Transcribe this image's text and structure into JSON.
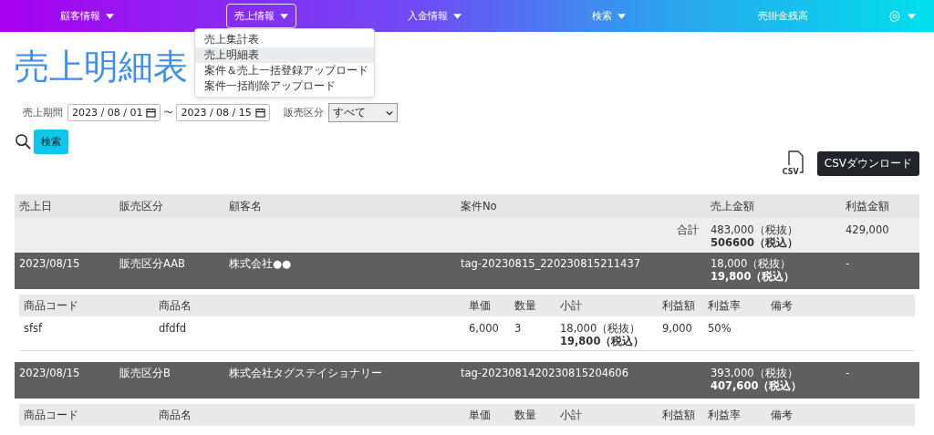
{
  "nav": {
    "items": [
      {
        "label": "顧客情報",
        "caret": true,
        "selected": false
      },
      {
        "label": "売上情報",
        "caret": true,
        "selected": true
      },
      {
        "label": "入金情報",
        "caret": true,
        "selected": false
      },
      {
        "label": "検索",
        "caret": true,
        "selected": false
      },
      {
        "label": "売掛金残高",
        "caret": false,
        "selected": false
      }
    ],
    "settings_caret": true
  },
  "dropdown": {
    "items": [
      {
        "label": "売上集計表",
        "selected": false
      },
      {
        "label": "売上明細表",
        "selected": true
      },
      {
        "label": "案件＆売上一括登録アップロード",
        "selected": false
      },
      {
        "label": "案件一括削除アップロード",
        "selected": false
      }
    ]
  },
  "page_title": "売上明細表",
  "filters": {
    "period_label": "売上期間",
    "date_from": "2023 / 08 / 01",
    "separator": "〜",
    "date_to": "2023 / 08 / 15",
    "category_label": "販売区分",
    "category_value": "すべて"
  },
  "search_button": "検索",
  "csv": {
    "icon_text": "CSV",
    "button": "CSVダウンロード"
  },
  "table": {
    "columns": [
      "売上日",
      "販売区分",
      "顧客名",
      "案件No",
      "売上金額",
      "利益金額"
    ],
    "total": {
      "label": "合計",
      "amount_excl": "483,000（税抜）",
      "amount_incl": "506600（税込）",
      "profit": "429,000"
    },
    "orders": [
      {
        "date": "2023/08/15",
        "category": "販売区分AAB",
        "customer": "株式会社●●",
        "case_no": "tag-20230815_220230815211437",
        "amount_excl": "18,000（税抜）",
        "amount_incl": "19,800（税込）",
        "profit": "-",
        "detail_columns": [
          "商品コード",
          "商品名",
          "単価",
          "数量",
          "小計",
          "利益額",
          "利益率",
          "備考"
        ],
        "items": [
          {
            "code": "sfsf",
            "name": "dfdfd",
            "unit_price": "6,000",
            "qty": "3",
            "subtotal_excl": "18,000（税抜）",
            "subtotal_incl": "19,800（税込）",
            "profit": "9,000",
            "rate": "50%"
          }
        ]
      },
      {
        "date": "2023/08/15",
        "category": "販売区分B",
        "customer": "株式会社タグステイショナリー",
        "case_no": "tag-2023081420230815204606",
        "amount_excl": "393,000（税抜）",
        "amount_incl": "407,600（税込）",
        "profit": "-",
        "detail_columns": [
          "商品コード",
          "商品名",
          "単価",
          "数量",
          "小計",
          "利益額",
          "利益率",
          "備考"
        ]
      }
    ]
  }
}
